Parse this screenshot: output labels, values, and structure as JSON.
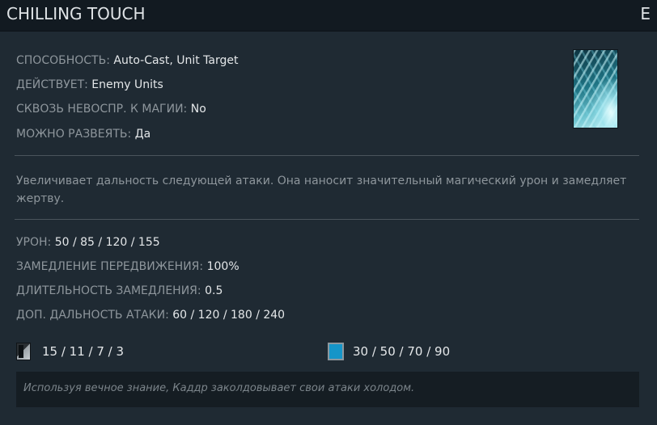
{
  "header": {
    "title": "CHILLING TOUCH",
    "hotkey": "E"
  },
  "ability_icon": "chilling-touch-ice-icon",
  "attributes": [
    {
      "label": "СПОСОБНОСТЬ:",
      "value": "Auto-Cast, Unit Target"
    },
    {
      "label": "ДЕЙСТВУЕТ:",
      "value": "Enemy Units"
    },
    {
      "label": "СКВОЗЬ НЕВОСПР. К МАГИИ:",
      "value": "No"
    },
    {
      "label": "МОЖНО РАЗВЕЯТЬ:",
      "value": "Да"
    }
  ],
  "description": "Увеличивает дальность следующей атаки. Она наносит значительный магический урон и замедляет жертву.",
  "stats": [
    {
      "label": "УРОН:",
      "value": "50 / 85 / 120 / 155"
    },
    {
      "label": "ЗАМЕДЛЕНИЕ ПЕРЕДВИЖЕНИЯ:",
      "value": "100%"
    },
    {
      "label": "ДЛИТЕЛЬНОСТЬ ЗАМЕДЛЕНИЯ:",
      "value": "0.5"
    },
    {
      "label": "ДОП. ДАЛЬНОСТЬ АТАКИ:",
      "value": "60 / 120 / 180 / 240"
    }
  ],
  "cooldown": {
    "icon": "cooldown-icon",
    "value": "15 / 11 / 7 / 3"
  },
  "mana_cost": {
    "icon": "mana-icon",
    "value": "30 / 50 / 70 / 90"
  },
  "lore": "Используя вечное знание, Каддр заколдовывает свои атаки холодом.",
  "colors": {
    "header_bg": "#121a21",
    "body_bg": "#1f2a33",
    "label": "#8e969c",
    "value": "#e4e7e9",
    "mana": "#1595c8",
    "lore_bg": "#151d23"
  }
}
